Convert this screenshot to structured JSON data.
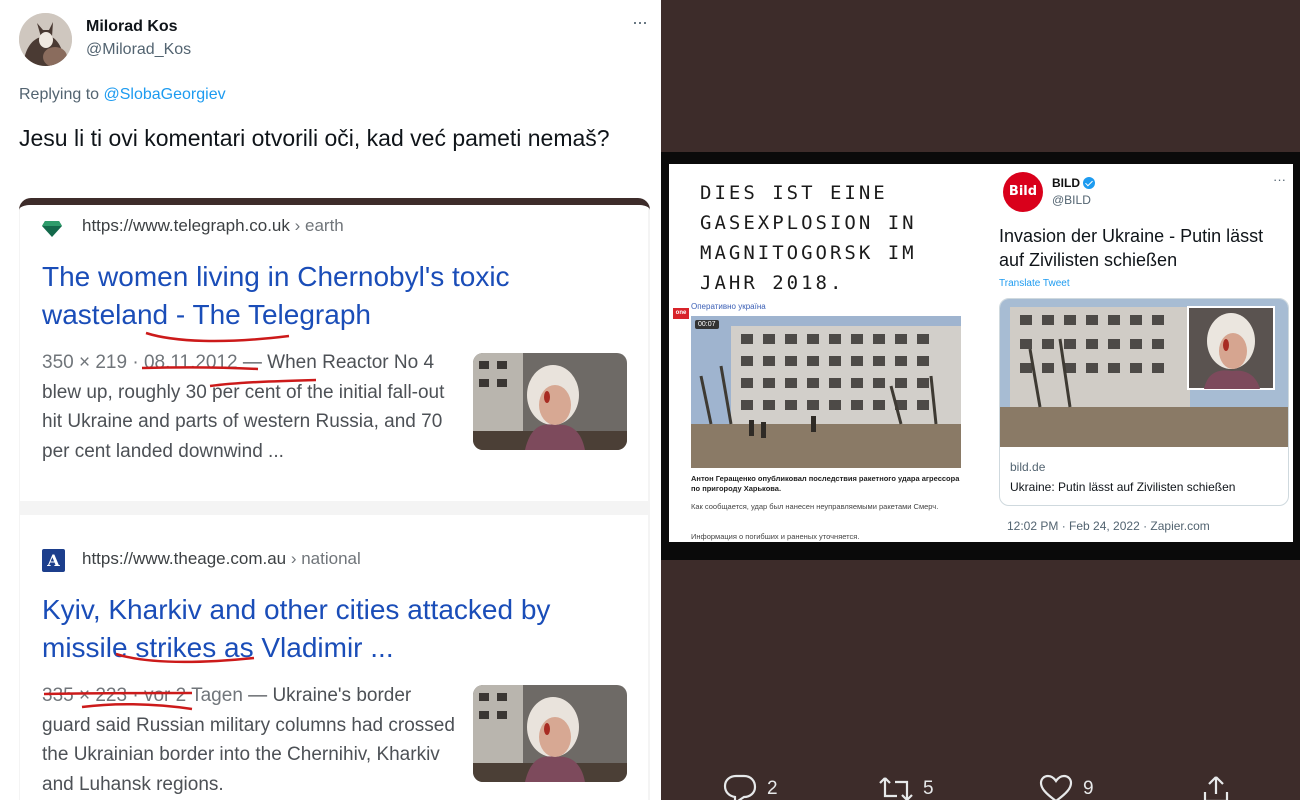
{
  "tweet": {
    "author_name": "Milorad Kos",
    "author_handle": "@Milorad_Kos",
    "more_label": "···",
    "replying_prefix": "Replying to",
    "replying_to": "@SlobaGeorgiev",
    "text": "Jesu li ti ovi komentari otvorili oči, kad već pameti nemaš?"
  },
  "search_results": [
    {
      "site": "https://www.telegraph.co.uk",
      "crumb": " › earth",
      "title": "The women living in Chernobyl's toxic wasteland - The Telegraph",
      "meta": "350 × 219 · 08.11.2012",
      "snippet": " — When Reactor No 4 blew up, roughly 30 per cent of the initial fall-out hit Ukraine and parts of western Russia, and 70 per cent landed downwind ..."
    },
    {
      "site": "https://www.theage.com.au",
      "crumb": " › national",
      "icon_letter": "A",
      "title": "Kyiv, Kharkiv and other cities attacked by missile strikes as Vladimir ...",
      "meta": "335 × 223 · vor 2 Tagen",
      "snippet": " — Ukraine's border guard said Russian military columns had crossed the Ukrainian border into the Chernihiv, Kharkiv and Luhansk regions."
    }
  ],
  "media": {
    "caption": "DIES IST EINE GASEXPLOSION IN MAGNITOGORSK IM JAHR 2018.",
    "tv_channel": "Оперативно україна",
    "tv_logo": "one",
    "tv_time": "00:07",
    "ru_headline": "Антон Геращенко опубликовал последствия ракетного удара агрессора по пригороду Харькова.",
    "ru_line1": "Как сообщается, удар был нанесен неуправляемыми ракетами Смерч.",
    "ru_line2": "Информация о погибших и раненых уточняется.",
    "bild": {
      "logo": "Bild",
      "name": "BILD",
      "handle": "@BILD",
      "more": "···",
      "text": "Invasion der Ukraine - Putin lässt auf Zivilisten schießen",
      "translate": "Translate Tweet",
      "link_domain": "bild.de",
      "link_title": "Ukraine: Putin lässt auf Zivilisten schießen",
      "timestamp": "12:02 PM · Feb 24, 2022 · Zapier.com"
    }
  },
  "actions": {
    "replies": "2",
    "retweets": "5",
    "likes": "9"
  },
  "colors": {
    "link_blue": "#1a4db8",
    "twitter_blue": "#1d9bf0",
    "panel_bg": "#3d2c2a",
    "underline_red": "#cc1a1a",
    "bild_red": "#d9001b"
  }
}
